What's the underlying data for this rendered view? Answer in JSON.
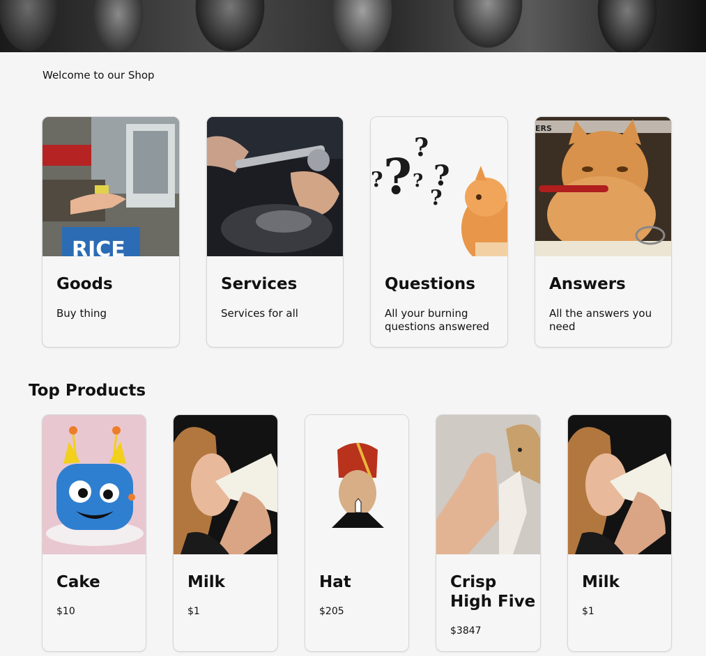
{
  "header": {
    "welcome": "Welcome to our Shop"
  },
  "categories": [
    {
      "title": "Goods",
      "desc": "Buy thing",
      "icon": "checkout-photo"
    },
    {
      "title": "Services",
      "desc": "Services for all",
      "icon": "wrench-photo"
    },
    {
      "title": "Questions",
      "desc": "All your burning questions answered",
      "icon": "question-cat-photo"
    },
    {
      "title": "Answers",
      "desc": "All the answers you need",
      "icon": "cat-glasses-photo"
    }
  ],
  "top_products": {
    "title": "Top Products",
    "items": [
      {
        "title": "Cake",
        "price": "$10",
        "icon": "monster-cake-photo"
      },
      {
        "title": "Milk",
        "price": "$1",
        "icon": "woman-drinking-milk-photo"
      },
      {
        "title": "Hat",
        "price": "$205",
        "icon": "fez-hat-photo"
      },
      {
        "title": "Crisp High Five",
        "price": "$3847",
        "icon": "dog-high-five-photo"
      },
      {
        "title": "Milk",
        "price": "$1",
        "icon": "woman-drinking-milk-photo"
      }
    ]
  }
}
